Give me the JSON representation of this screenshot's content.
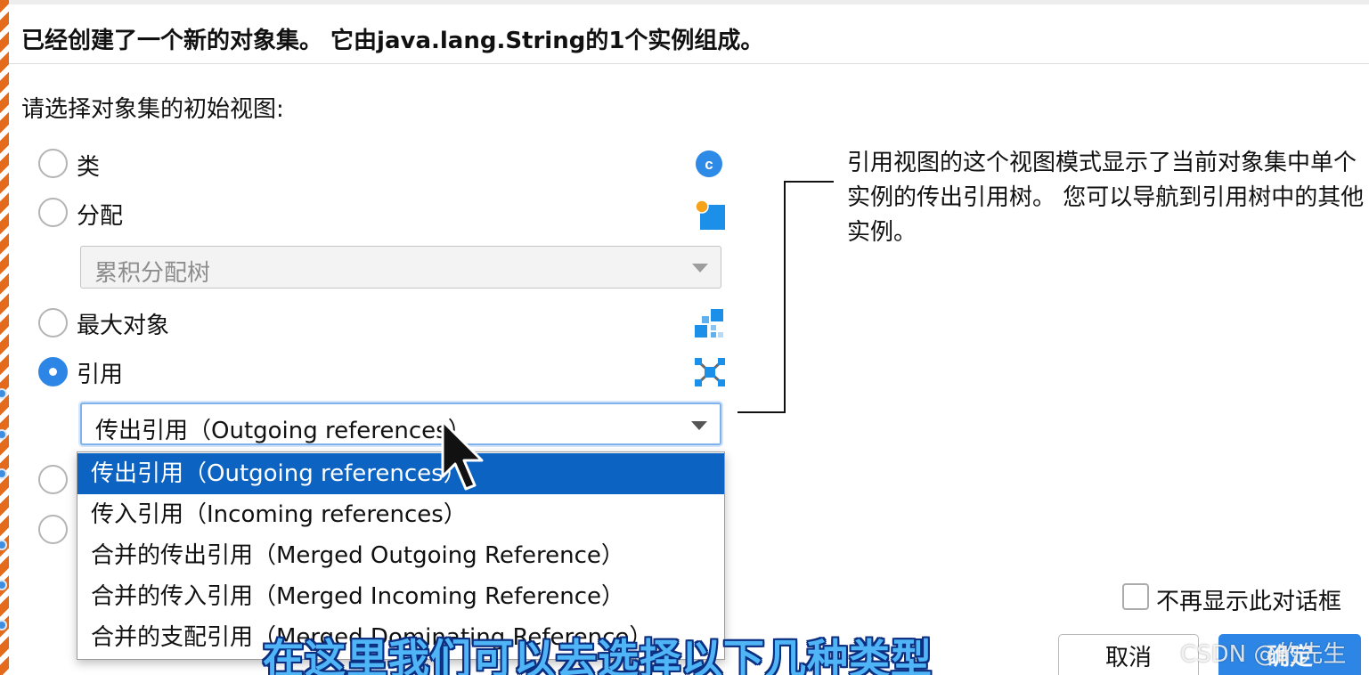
{
  "header": {
    "title": "已经创建了一个新的对象集。 它由java.lang.String的1个实例组成。"
  },
  "prompt": "请选择对象集的初始视图:",
  "options": [
    {
      "label": "类",
      "icon": "class-icon",
      "checked": false
    },
    {
      "label": "分配",
      "icon": "allocation-icon",
      "checked": false
    },
    {
      "label": "最大对象",
      "icon": "biggest-objects-icon",
      "checked": false
    },
    {
      "label": "引用",
      "icon": "references-icon",
      "checked": true
    }
  ],
  "allocation_combo": {
    "value": "累积分配树",
    "enabled": false
  },
  "references_combo": {
    "value": "传出引用（Outgoing references）"
  },
  "dropdown_items": [
    "传出引用（Outgoing references）",
    "传入引用（Incoming references）",
    "合并的传出引用（Merged Outgoing Reference）",
    "合并的传入引用（Merged Incoming Reference）",
    "合并的支配引用（Merged Dominating Reference）"
  ],
  "dropdown_selected_index": 0,
  "description": "引用视图的这个视图模式显示了当前对象集中单个实例的传出引用树。 您可以导航到引用树中的其他实例。",
  "dont_show_again": {
    "label": "不再显示此对话框",
    "checked": false
  },
  "buttons": {
    "cancel": "取消",
    "ok": "确定"
  },
  "subtitle": "在这里我们可以去选择以下几种类型",
  "watermark": "CSDN @的先生",
  "colors": {
    "accent": "#2d86e6",
    "selection": "#0c63c2",
    "stripe": "#e46a1c",
    "subtitle": "#4fb5f6"
  }
}
